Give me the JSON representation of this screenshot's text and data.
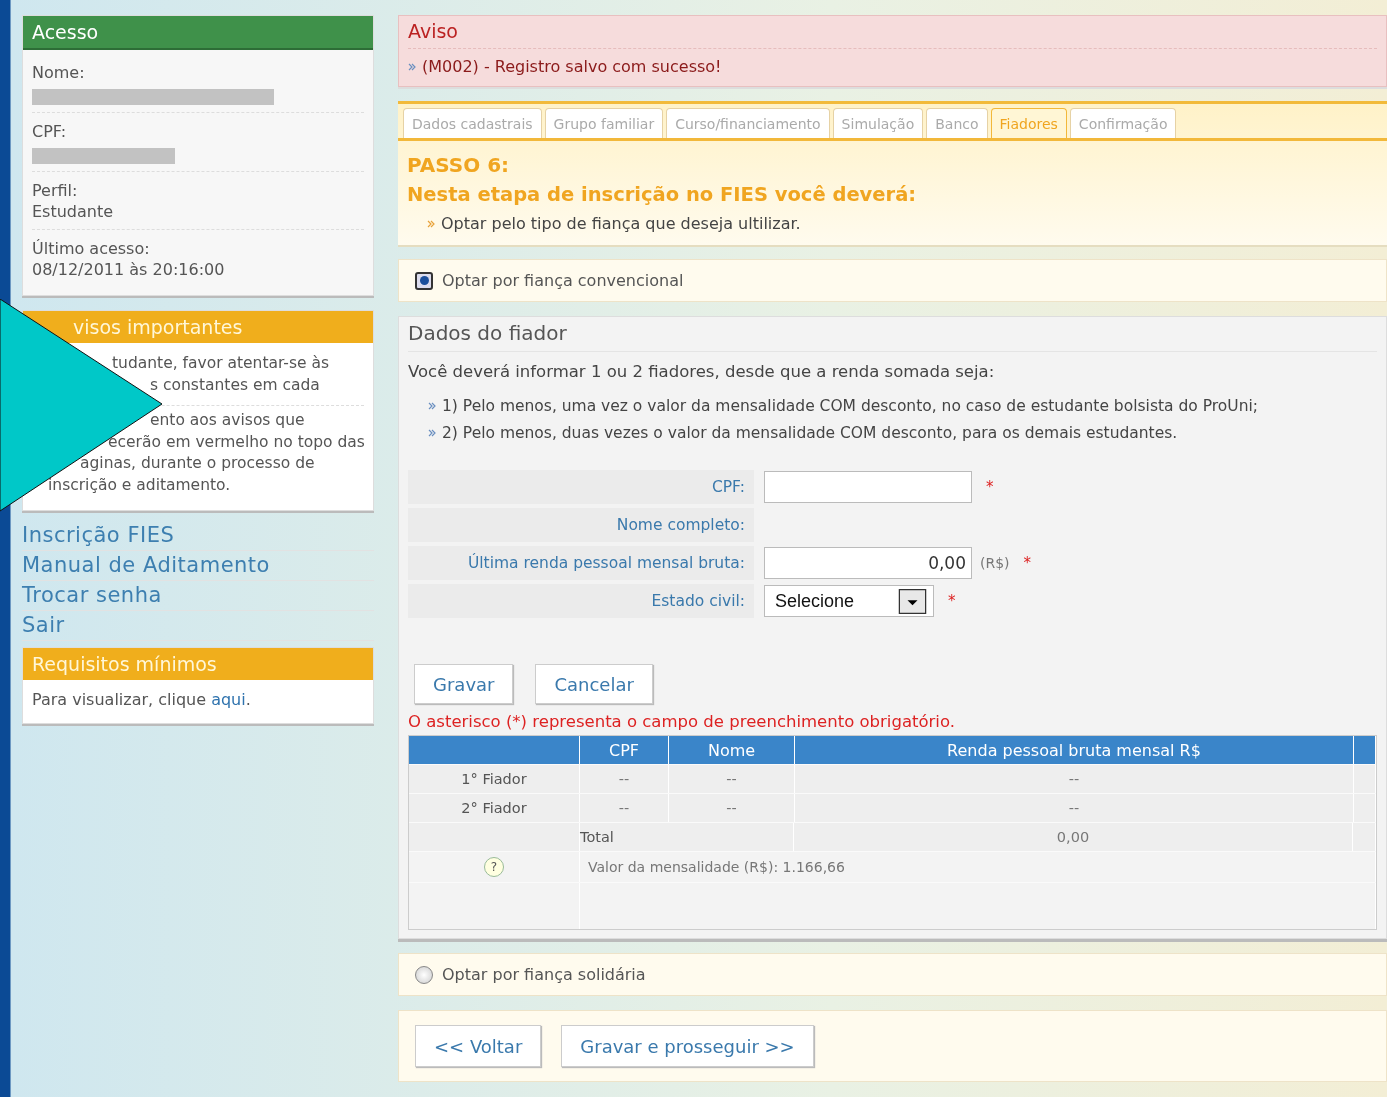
{
  "access": {
    "title": "Acesso",
    "fields": [
      {
        "label": "Nome:",
        "redacted": true
      },
      {
        "label": "CPF:",
        "redacted": true
      },
      {
        "label": "Perfil:",
        "value": "Estudante",
        "redacted": false
      },
      {
        "label": "Último acesso:",
        "value": "08/12/2011 às 20:16:00",
        "redacted": false
      }
    ]
  },
  "notices": {
    "title": "visos importantes",
    "paragraphs": [
      [
        "tudante, favor atentar-se às",
        "s constantes em cada"
      ],
      [
        "ento aos avisos que",
        "ecerão em vermelho no topo das",
        "aginas, durante o processo de",
        "inscrição e aditamento."
      ]
    ]
  },
  "nav_links": [
    "Inscrição FIES",
    "Manual de Aditamento",
    "Trocar senha",
    "Sair"
  ],
  "requirements": {
    "title": "Requisitos mínimos",
    "text_before": "Para visualizar, clique ",
    "link": "aqui",
    "text_after": "."
  },
  "alert": {
    "title": "Aviso",
    "messages": [
      "(M002) - Registro salvo com sucesso!"
    ]
  },
  "tabs": [
    {
      "label": "Dados cadastrais",
      "selected": false
    },
    {
      "label": "Grupo familiar",
      "selected": false
    },
    {
      "label": "Curso/financiamento",
      "selected": false
    },
    {
      "label": "Simulação",
      "selected": false
    },
    {
      "label": "Banco",
      "selected": false
    },
    {
      "label": "Fiadores",
      "selected": true
    },
    {
      "label": "Confirmação",
      "selected": false
    }
  ],
  "step": {
    "title": "PASSO 6:",
    "subtitle": "Nesta etapa de inscrição no FIES você deverá:",
    "items": [
      "Optar pelo tipo de fiança que deseja ultilizar."
    ]
  },
  "option_conventional": {
    "label": "Optar por fiança convencional",
    "selected": true
  },
  "guarantor": {
    "title": "Dados do fiador",
    "intro": "Você deverá informar 1 ou 2 fiadores, desde que a renda somada seja:",
    "rules": [
      "1) Pelo menos, uma vez o valor da mensalidade COM desconto, no caso de estudante bolsista do ProUni;",
      "2) Pelo menos, duas vezes o valor da mensalidade COM desconto, para os demais estudantes."
    ],
    "form": [
      {
        "kind": "input",
        "label": "CPF:",
        "required": true
      },
      {
        "kind": "text",
        "label": "Nome completo:",
        "required": false
      },
      {
        "kind": "money",
        "label": "Última renda pessoal mensal bruta:",
        "value": "0,00",
        "unit": "(R$)",
        "required": true
      },
      {
        "kind": "select",
        "label": "Estado civil:",
        "value": "Selecione",
        "required": true
      }
    ],
    "required_mark": "*",
    "buttons": [
      "Gravar",
      "Cancelar"
    ],
    "required_note": "O asterisco (*) representa o campo de preenchimento obrigatório.",
    "table": {
      "columns": [
        "CPF",
        "Nome",
        "Renda pessoal bruta mensal R$"
      ],
      "rows": [
        {
          "label": "1° Fiador",
          "cpf": "--",
          "nome": "--",
          "renda": "--"
        },
        {
          "label": "2° Fiador",
          "cpf": "--",
          "nome": "--",
          "renda": "--"
        }
      ],
      "total": {
        "label": "Total",
        "value": "0,00"
      },
      "info": {
        "icon": "?",
        "text": "Valor da mensalidade (R$): 1.166,66"
      }
    }
  },
  "option_solidarity": {
    "label": "Optar por fiança solidária",
    "selected": false
  },
  "nav_buttons": [
    "<< Voltar",
    "Gravar e prosseguir >>"
  ]
}
